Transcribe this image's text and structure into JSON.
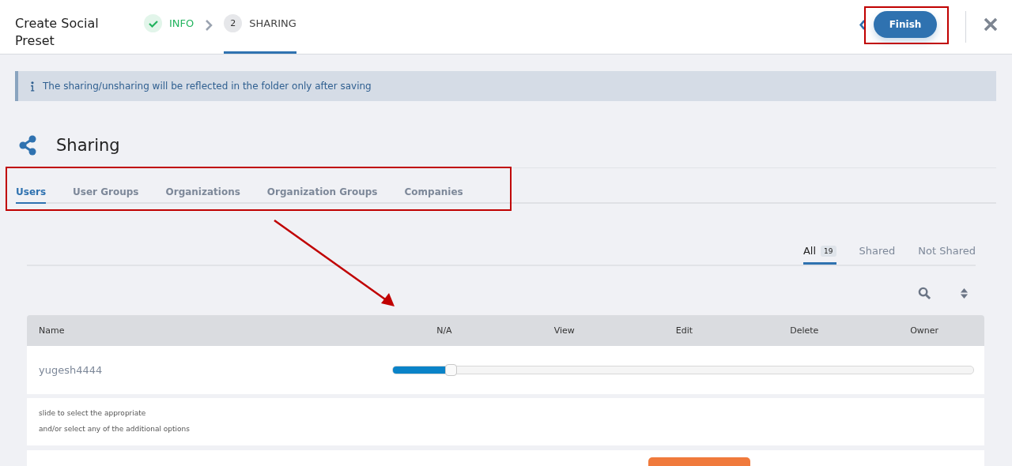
{
  "header": {
    "title": "Create Social Preset",
    "steps": [
      {
        "label": "INFO",
        "completed": true,
        "selected": false
      },
      {
        "number": "2",
        "label": "SHARING",
        "completed": false,
        "selected": true
      }
    ],
    "finish_button": "Finish"
  },
  "info_banner": "The sharing/unsharing will be reflected in the folder only after saving",
  "section": {
    "title": "Sharing"
  },
  "tabs": [
    {
      "label": "Users",
      "selected": true
    },
    {
      "label": "User Groups",
      "selected": false
    },
    {
      "label": "Organizations",
      "selected": false
    },
    {
      "label": "Organization Groups",
      "selected": false
    },
    {
      "label": "Companies",
      "selected": false
    }
  ],
  "filters": [
    {
      "label": "All",
      "count": "19",
      "selected": true
    },
    {
      "label": "Shared",
      "selected": false
    },
    {
      "label": "Not Shared",
      "selected": false
    }
  ],
  "table": {
    "columns": [
      "Name",
      "N/A",
      "View",
      "Edit",
      "Delete",
      "Owner"
    ],
    "rows": [
      {
        "name": "yugesh4444",
        "level": 0.1
      }
    ],
    "hint": [
      "slide to select the appropriate",
      "and/or select any of the additional options"
    ]
  }
}
